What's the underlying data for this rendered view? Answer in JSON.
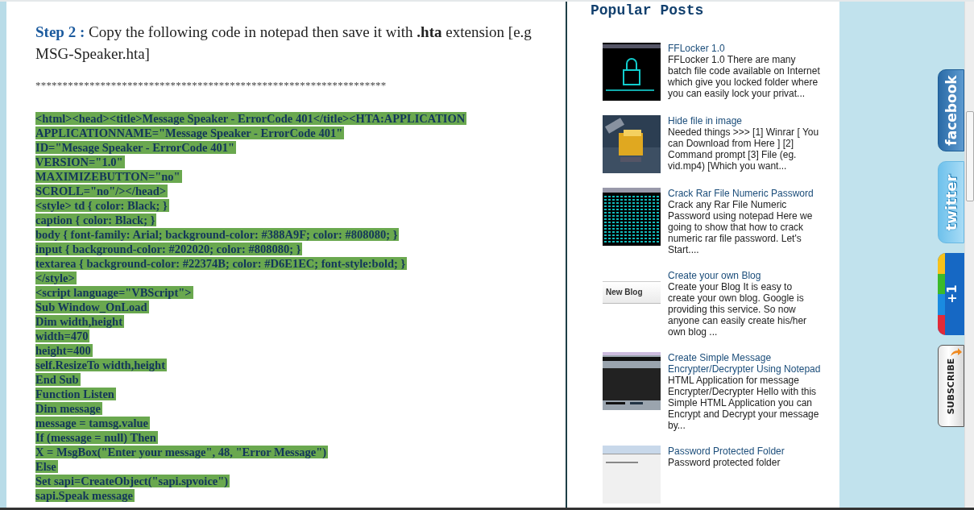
{
  "article": {
    "step_label": "Step 2 :",
    "step_text": "Copy the following code in notepad then save it with **.hta** extension [e.g MSG-Speaker.hta]",
    "separator": "*****************************************************************",
    "code_lines": [
      "<html><head><title>Message Speaker - ErrorCode 401</title><HTA:APPLICATION",
      "APPLICATIONNAME=\"Message Speaker - ErrorCode 401\"",
      "ID=\"Mesage Speaker - ErrorCode 401\"",
      "VERSION=\"1.0\"",
      "MAXIMIZEBUTTON=\"no\"",
      "SCROLL=\"no\"/></head>",
      "<style> td { color: Black; }",
      "caption { color: Black; }",
      "body { font-family: Arial; background-color: #388A9F; color: #808080; }",
      "input { background-color: #202020; color: #808080; }",
      "textarea { background-color: #22374B; color: #D6E1EC; font-style:bold; }",
      "</style>",
      "<script language=\"VBScript\">",
      "Sub Window_OnLoad",
      "Dim width,height",
      "width=470",
      "height=400",
      "self.ResizeTo width,height",
      "End Sub",
      "Function Listen",
      "Dim message",
      "message = tamsg.value",
      "If (message = null) Then",
      "X = MsgBox(\"Enter your message\", 48, \"Error Message\")",
      "Else",
      "Set sapi=CreateObject(\"sapi.spvoice\")",
      "sapi.Speak message"
    ]
  },
  "sidebar": {
    "title": "Popular Posts",
    "posts": [
      {
        "title": "FFLocker 1.0",
        "snippet": "FFLocker 1.0 There are many batch file code available on Internet which give you locked folder where you can easily lock your privat...",
        "kind": "picture"
      },
      {
        "title": "Hide file in image",
        "snippet": "Needed things >>> [1]  Winrar [ You can Download from Here ] [2] Command prompt [3] File (eg. vid.mp4) [Which you want...",
        "kind": "picture"
      },
      {
        "title": "Crack Rar File Numeric Password",
        "snippet": "Crack any Rar File Numeric Password using notepad Here we going to show that how to crack numeric rar file password. Let's Start....",
        "kind": "picture"
      },
      {
        "title": "Create your own Blog",
        "snippet": "Create your Blog It is easy to create your own blog. Google is providing this service. So now anyone can easily create his/her own blog ...",
        "kind": "text_thumb",
        "thumb_text": "New Blog"
      },
      {
        "title": "Create Simple Message Encrypter/Decrypter Using Notepad",
        "snippet": "HTML Application for message Encrypter/Decrypter Hello with this Simple HTML Application you can Encrypt and Decrypt your message by...",
        "kind": "picture"
      },
      {
        "title": "Password Protected Folder",
        "snippet": "Password protected folder",
        "kind": "picture"
      }
    ]
  },
  "social_tabs": [
    {
      "kind": "facebook",
      "label": "facebook"
    },
    {
      "kind": "twitter",
      "label": "twitter"
    },
    {
      "kind": "plusone",
      "label": "+1"
    },
    {
      "kind": "subscribe",
      "label": "SUBSCRIBE"
    }
  ]
}
